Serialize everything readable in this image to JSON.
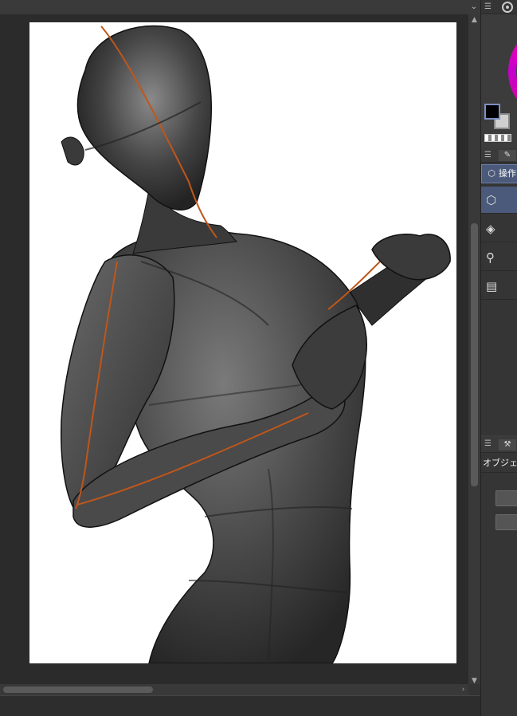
{
  "right_panel": {
    "color": {
      "main_color": "#000000",
      "sub_color": "#cfcfcf",
      "main_border": "#7e8fc4"
    },
    "tool": {
      "active_tab_label": "操作",
      "subtools": [
        {
          "icon": "object-select-icon",
          "active": true
        },
        {
          "icon": "layer-select-icon",
          "active": false
        },
        {
          "icon": "light-source-icon",
          "active": false
        },
        {
          "icon": "timeline-icon",
          "active": false
        }
      ]
    },
    "properties": {
      "title": "オブジェクト"
    }
  },
  "colors": {
    "accent": "#4b5a7a",
    "panel_bg": "#353535",
    "canvas_bg": "#2b2b2b",
    "paper": "#ffffff",
    "model_guide_line": "#c0561a"
  }
}
